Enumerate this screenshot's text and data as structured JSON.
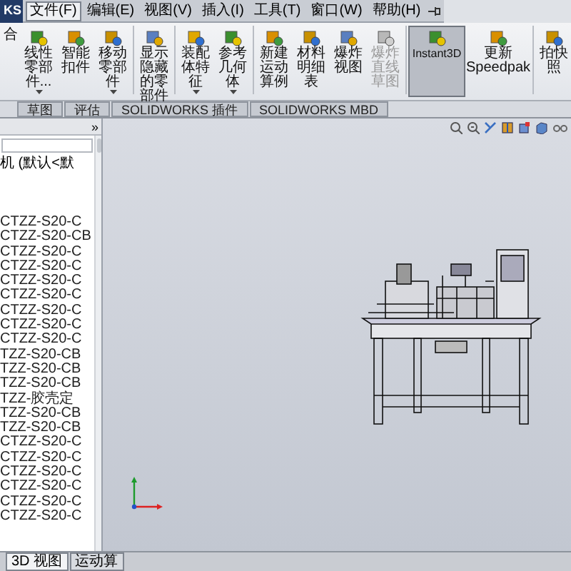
{
  "logo": "KS",
  "menu": [
    {
      "label": "文件(F)",
      "selected": true
    },
    {
      "label": "编辑(E)",
      "selected": false
    },
    {
      "label": "视图(V)",
      "selected": false
    },
    {
      "label": "插入(I)",
      "selected": false
    },
    {
      "label": "工具(T)",
      "selected": false
    },
    {
      "label": "窗口(W)",
      "selected": false
    },
    {
      "label": "帮助(H)",
      "selected": false
    }
  ],
  "ribbon": [
    {
      "label": "合",
      "dropdown": false,
      "disabled": false,
      "selected": false
    },
    {
      "label": "线性零部件...",
      "dropdown": true,
      "disabled": false,
      "selected": false
    },
    {
      "label": "智能扣件",
      "dropdown": false,
      "disabled": false,
      "selected": false
    },
    {
      "label": "移动零部件",
      "dropdown": true,
      "disabled": false,
      "selected": false
    },
    {
      "label": "显示隐藏的零部件",
      "dropdown": false,
      "disabled": false,
      "selected": false
    },
    {
      "label": "装配体特征",
      "dropdown": true,
      "disabled": false,
      "selected": false
    },
    {
      "label": "参考几何体",
      "dropdown": true,
      "disabled": false,
      "selected": false
    },
    {
      "label": "新建运动算例",
      "dropdown": false,
      "disabled": false,
      "selected": false
    },
    {
      "label": "材料明细表",
      "dropdown": false,
      "disabled": false,
      "selected": false
    },
    {
      "label": "爆炸视图",
      "dropdown": false,
      "disabled": false,
      "selected": false
    },
    {
      "label": "爆炸直线草图",
      "dropdown": false,
      "disabled": true,
      "selected": false
    },
    {
      "label": "Instant3D",
      "dropdown": false,
      "disabled": false,
      "selected": true
    },
    {
      "label": "更新Speedpak",
      "dropdown": false,
      "disabled": false,
      "selected": false
    },
    {
      "label": "拍快照",
      "dropdown": false,
      "disabled": false,
      "selected": false
    }
  ],
  "command_tabs": [
    "草图",
    "评估",
    "SOLIDWORKS 插件",
    "SOLIDWORKS MBD"
  ],
  "feature_tree": {
    "expand_glyph": "»",
    "root": "机 (默认<默",
    "items": [
      "CTZZ-S20-C",
      "CTZZ-S20-CB",
      "CTZZ-S20-C",
      "CTZZ-S20-C",
      "CTZZ-S20-C",
      "CTZZ-S20-C",
      "CTZZ-S20-C",
      "CTZZ-S20-C",
      "CTZZ-S20-C",
      "TZZ-S20-CB",
      "TZZ-S20-CB",
      "TZZ-S20-CB",
      "TZZ-胶壳定",
      "TZZ-S20-CB",
      "TZZ-S20-CB",
      "CTZZ-S20-C",
      "CTZZ-S20-C",
      "CTZZ-S20-C",
      "CTZZ-S20-C",
      "CTZZ-S20-C",
      "CTZZ-S20-C"
    ]
  },
  "bottom_tabs": [
    {
      "label": "3D 视图",
      "selected": true
    },
    {
      "label": "运动算",
      "selected": false
    }
  ]
}
